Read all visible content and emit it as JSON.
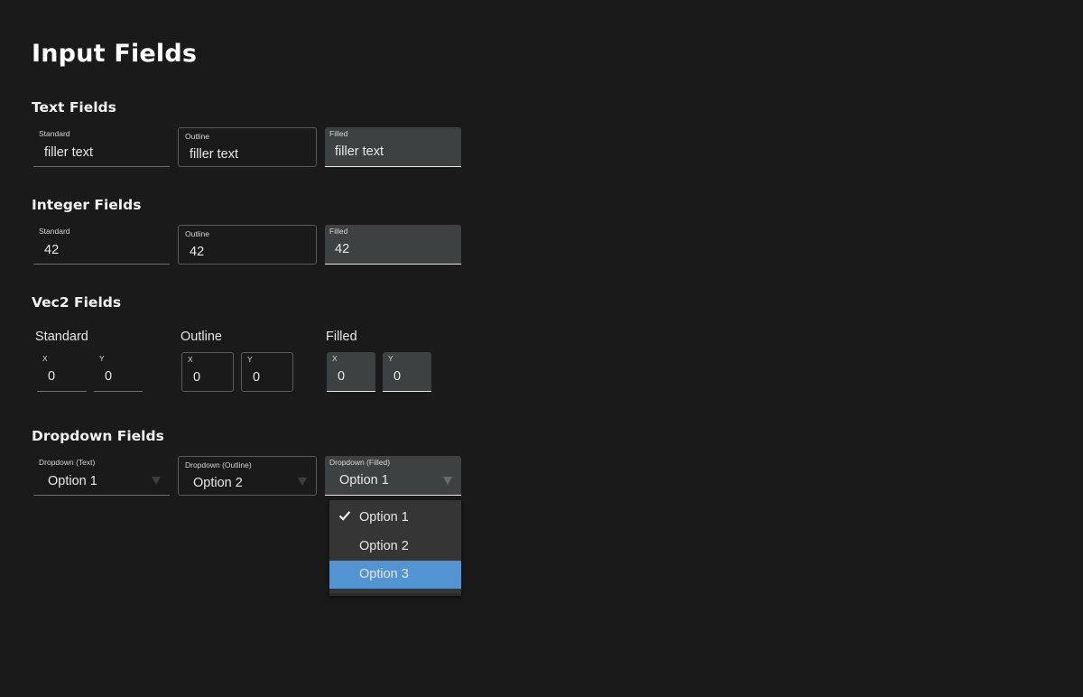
{
  "title": "Input Fields",
  "sections": {
    "text": "Text Fields",
    "integer": "Integer Fields",
    "vec2": "Vec2 Fields",
    "dropdown": "Dropdown Fields"
  },
  "text_fields": {
    "standard": {
      "label": "Standard",
      "value": "filler text"
    },
    "outline": {
      "label": "Outline",
      "value": "filler text"
    },
    "filled": {
      "label": "Filled",
      "value": "filler text"
    }
  },
  "integer_fields": {
    "standard": {
      "label": "Standard",
      "value": "42"
    },
    "outline": {
      "label": "Outline",
      "value": "42"
    },
    "filled": {
      "label": "Filled",
      "value": "42"
    }
  },
  "vec2_fields": {
    "standard": {
      "label": "Standard",
      "x_label": "X",
      "x_value": "0",
      "y_label": "Y",
      "y_value": "0"
    },
    "outline": {
      "label": "Outline",
      "x_label": "X",
      "x_value": "0",
      "y_label": "Y",
      "y_value": "0"
    },
    "filled": {
      "label": "Filled",
      "x_label": "X",
      "x_value": "0",
      "y_label": "Y",
      "y_value": "0"
    }
  },
  "dropdown_fields": {
    "text": {
      "label": "Dropdown (Text)",
      "value": "Option 1"
    },
    "outline": {
      "label": "Dropdown (Outline)",
      "value": "Option 2"
    },
    "filled": {
      "label": "Dropdown (Filled)",
      "value": "Option 1"
    }
  },
  "dropdown_menu": {
    "options": [
      "Option 1",
      "Option 2",
      "Option 3"
    ],
    "selected": "Option 1",
    "highlighted": "Option 3"
  },
  "colors": {
    "background": "#1a1a1a",
    "filled_bg": "#3e4142",
    "menu_bg": "#353535",
    "highlight": "#5294d2"
  }
}
